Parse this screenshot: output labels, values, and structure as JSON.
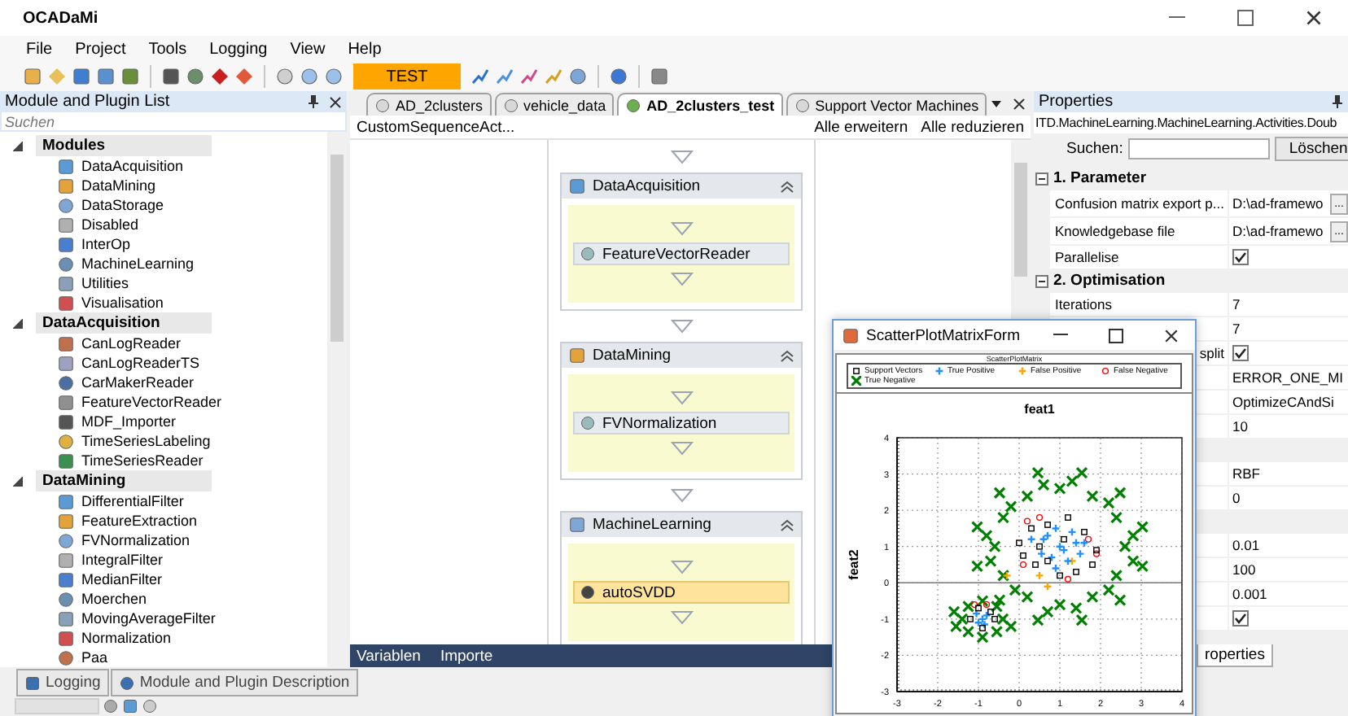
{
  "window": {
    "title": "OCADaMi"
  },
  "menu": [
    "File",
    "Project",
    "Tools",
    "Logging",
    "View",
    "Help"
  ],
  "toolbar": {
    "mode_label": "TEST"
  },
  "module_panel": {
    "title": "Module and Plugin List",
    "search": {
      "placeholder": "Suchen"
    },
    "groups": [
      {
        "label": "Modules",
        "expanded": true,
        "children": [
          {
            "label": "DataAcquisition"
          },
          {
            "label": "DataMining"
          },
          {
            "label": "DataStorage"
          },
          {
            "label": "Disabled"
          },
          {
            "label": "InterOp"
          },
          {
            "label": "MachineLearning"
          },
          {
            "label": "Utilities"
          },
          {
            "label": "Visualisation"
          }
        ]
      },
      {
        "label": "DataAcquisition",
        "expanded": true,
        "children": [
          {
            "label": "CanLogReader"
          },
          {
            "label": "CanLogReaderTS"
          },
          {
            "label": "CarMakerReader"
          },
          {
            "label": "FeatureVectorReader"
          },
          {
            "label": "MDF_Importer"
          },
          {
            "label": "TimeSeriesLabeling"
          },
          {
            "label": "TimeSeriesReader"
          }
        ]
      },
      {
        "label": "DataMining",
        "expanded": true,
        "children": [
          {
            "label": "DifferentialFilter"
          },
          {
            "label": "FeatureExtraction"
          },
          {
            "label": "FVNormalization"
          },
          {
            "label": "IntegralFilter"
          },
          {
            "label": "MedianFilter"
          },
          {
            "label": "Moerchen"
          },
          {
            "label": "MovingAverageFilter"
          },
          {
            "label": "Normalization"
          },
          {
            "label": "Paa"
          }
        ]
      }
    ]
  },
  "editor": {
    "tabs": [
      {
        "label": "AD_2clusters",
        "selected": false
      },
      {
        "label": "vehicle_data",
        "selected": false
      },
      {
        "label": "AD_2clusters_test",
        "selected": true
      },
      {
        "label": "Support Vector Machines",
        "selected": false
      }
    ],
    "breadcrumb": "CustomSequenceAct...",
    "actions": [
      "Alle erweitern",
      "Alle reduzieren"
    ],
    "blocks": [
      {
        "title": "DataAcquisition",
        "activity": {
          "label": "FeatureVectorReader",
          "selected": false
        }
      },
      {
        "title": "DataMining",
        "activity": {
          "label": "FVNormalization",
          "selected": false
        }
      },
      {
        "title": "MachineLearning",
        "activity": {
          "label": "autoSVDD",
          "selected": true
        }
      }
    ],
    "bottom_tabs": [
      "Variablen",
      "Importe"
    ]
  },
  "bottom_tabs": [
    "Logging",
    "Module and Plugin Description"
  ],
  "properties": {
    "title": "Properties",
    "object_type": "ITD.MachineLearning.MachineLearning.Activities.Doub",
    "search_label": "Suchen:",
    "clear_button": "Löschen",
    "rows": [
      {
        "kind": "category",
        "label": "1. Parameter",
        "expanded": true
      },
      {
        "kind": "file",
        "label": "Confusion matrix export p...",
        "value": "D:\\ad-framewo",
        "button": "..."
      },
      {
        "kind": "file",
        "label": "Knowledgebase file",
        "value": "D:\\ad-framewo",
        "button": "..."
      },
      {
        "kind": "check",
        "label": "Parallelise",
        "checked": true
      },
      {
        "kind": "category",
        "label": "2. Optimisation",
        "expanded": true
      },
      {
        "kind": "text",
        "label": "Iterations",
        "value": "7"
      },
      {
        "kind": "text",
        "value": "7"
      },
      {
        "kind": "check",
        "label": "split",
        "label_covered": true,
        "checked": true
      },
      {
        "kind": "text",
        "value": "ERROR_ONE_MI"
      },
      {
        "kind": "text",
        "value": "OptimizeCAndSi"
      },
      {
        "kind": "text",
        "value": "10"
      },
      {
        "kind": "category"
      },
      {
        "kind": "text",
        "value": "RBF"
      },
      {
        "kind": "text",
        "value": "0"
      },
      {
        "kind": "category"
      },
      {
        "kind": "text",
        "value": "0.01"
      },
      {
        "kind": "text",
        "value": "100"
      },
      {
        "kind": "text",
        "value": "0.001"
      },
      {
        "kind": "check",
        "checked": true
      }
    ],
    "tab": "roperties"
  },
  "scatter_window": {
    "title": "ScatterPlotMatrixForm",
    "plot_title": "ScatterPlotMatrix",
    "chart_data": {
      "type": "scatter",
      "grid": true,
      "xlabel": "feat1",
      "ylabel": "feat2",
      "xlim": [
        -3,
        4
      ],
      "ylim": [
        -3,
        4
      ],
      "xticks": [
        -3,
        -2,
        -1,
        0,
        1,
        2,
        3,
        4
      ],
      "yticks": [
        -3,
        -2,
        -1,
        0,
        1,
        2,
        3,
        4
      ],
      "series": [
        {
          "name": "Support Vectors",
          "color": "#000000",
          "marker": "square",
          "x": [
            0,
            0.3,
            0.7,
            1.2,
            1.6,
            1.9,
            1.8,
            1.4,
            1,
            0.4,
            0.1,
            0.5,
            1.1,
            0.7,
            -1.2,
            -1,
            -0.7,
            -0.9,
            -0.6
          ],
          "values": [
            1.1,
            1.5,
            1.6,
            1.8,
            1.4,
            0.9,
            0.5,
            0.3,
            0.2,
            0.5,
            0.75,
            1,
            1.2,
            0.6,
            -1,
            -0.7,
            -0.8,
            -1.25,
            -1
          ]
        },
        {
          "name": "True Positive",
          "color": "#1e90ff",
          "marker": "plus",
          "x": [
            1,
            0.6,
            1.4,
            0.8,
            1.2,
            0.55,
            1.5,
            0.9,
            1.3,
            0.7,
            1.1,
            0.3,
            1.6,
            0.9,
            -0.9,
            -0.8,
            -1,
            -0.85,
            -1.05
          ],
          "values": [
            1,
            1.2,
            1.1,
            0.7,
            0.6,
            0.8,
            0.8,
            1.5,
            1.4,
            1.3,
            0.9,
            1.2,
            1.1,
            0.4,
            -1,
            -0.9,
            -1.1,
            -1.15,
            -0.85
          ]
        },
        {
          "name": "False Positive",
          "color": "#ffa500",
          "marker": "plus",
          "x": [
            0.5,
            0.7,
            -0.3,
            1.3
          ],
          "values": [
            0.2,
            -0.1,
            0.2,
            0.6
          ]
        },
        {
          "name": "False Negative",
          "color": "#ff0000",
          "marker": "circle",
          "x": [
            0.2,
            0.5,
            1.7,
            1.9,
            1.2,
            -1.1,
            -0.8,
            0.1
          ],
          "values": [
            1.7,
            1.8,
            1.2,
            0.8,
            0.1,
            -0.6,
            -0.6,
            0.5
          ]
        },
        {
          "name": "True Negative",
          "color": "#008000",
          "marker": "cross",
          "x": [
            2.6,
            3.03,
            2.39,
            2.48,
            1.8,
            1.54,
            1,
            0.46,
            0.2,
            -0.48,
            -0.39,
            -1.03,
            -0.6,
            -1.03,
            -0.39,
            -0.48,
            0.2,
            0.46,
            1,
            1.54,
            1.8,
            2.48,
            2.39,
            3.03,
            2.8,
            2.2,
            1.3,
            0.6,
            -0.2,
            -0.8,
            -0.7,
            -0.1,
            0.7,
            1.4,
            2.2,
            2.8,
            -1.55,
            -1.4,
            -0.4,
            -0.9,
            -0.9,
            -1.25,
            -0.55,
            -1.25,
            -0.55,
            -1.6,
            -0.2
          ],
          "values": [
            1,
            1.54,
            1.8,
            2.48,
            2.39,
            3.03,
            2.6,
            3.03,
            2.39,
            2.48,
            1.8,
            1.54,
            1,
            0.46,
            0.2,
            -0.48,
            -0.39,
            -1.03,
            -0.6,
            -1.03,
            -0.39,
            -0.48,
            0.2,
            0.46,
            1.3,
            2.2,
            2.8,
            2.7,
            2.1,
            1.3,
            0.6,
            -0.2,
            -0.8,
            -0.7,
            -0.2,
            0.6,
            -1.2,
            -1,
            -1,
            -0.5,
            -1.5,
            -0.65,
            -0.65,
            -1.35,
            -1.35,
            -0.8,
            -1.2
          ]
        }
      ]
    }
  }
}
